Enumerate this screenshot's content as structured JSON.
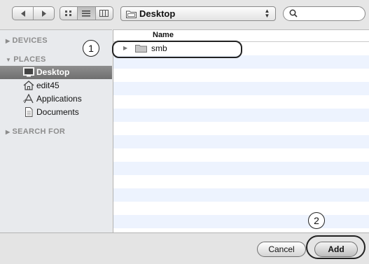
{
  "toolbar": {
    "location": "Desktop",
    "search_placeholder": ""
  },
  "sidebar": {
    "sections": [
      {
        "label": "DEVICES",
        "expanded": false
      },
      {
        "label": "PLACES",
        "expanded": true
      },
      {
        "label": "SEARCH FOR",
        "expanded": false
      }
    ],
    "places": [
      {
        "label": "Desktop",
        "icon": "desktop-icon",
        "selected": true
      },
      {
        "label": "edit45",
        "icon": "home-icon",
        "selected": false
      },
      {
        "label": "Applications",
        "icon": "applications-icon",
        "selected": false
      },
      {
        "label": "Documents",
        "icon": "documents-icon",
        "selected": false
      }
    ]
  },
  "list": {
    "column_name": "Name",
    "items": [
      {
        "name": "smb",
        "type": "folder"
      }
    ]
  },
  "buttons": {
    "cancel": "Cancel",
    "add": "Add"
  },
  "callouts": {
    "one": "1",
    "two": "2"
  },
  "colors": {
    "row_alt": "#edf3fe",
    "selection": "#7f7f7f"
  }
}
